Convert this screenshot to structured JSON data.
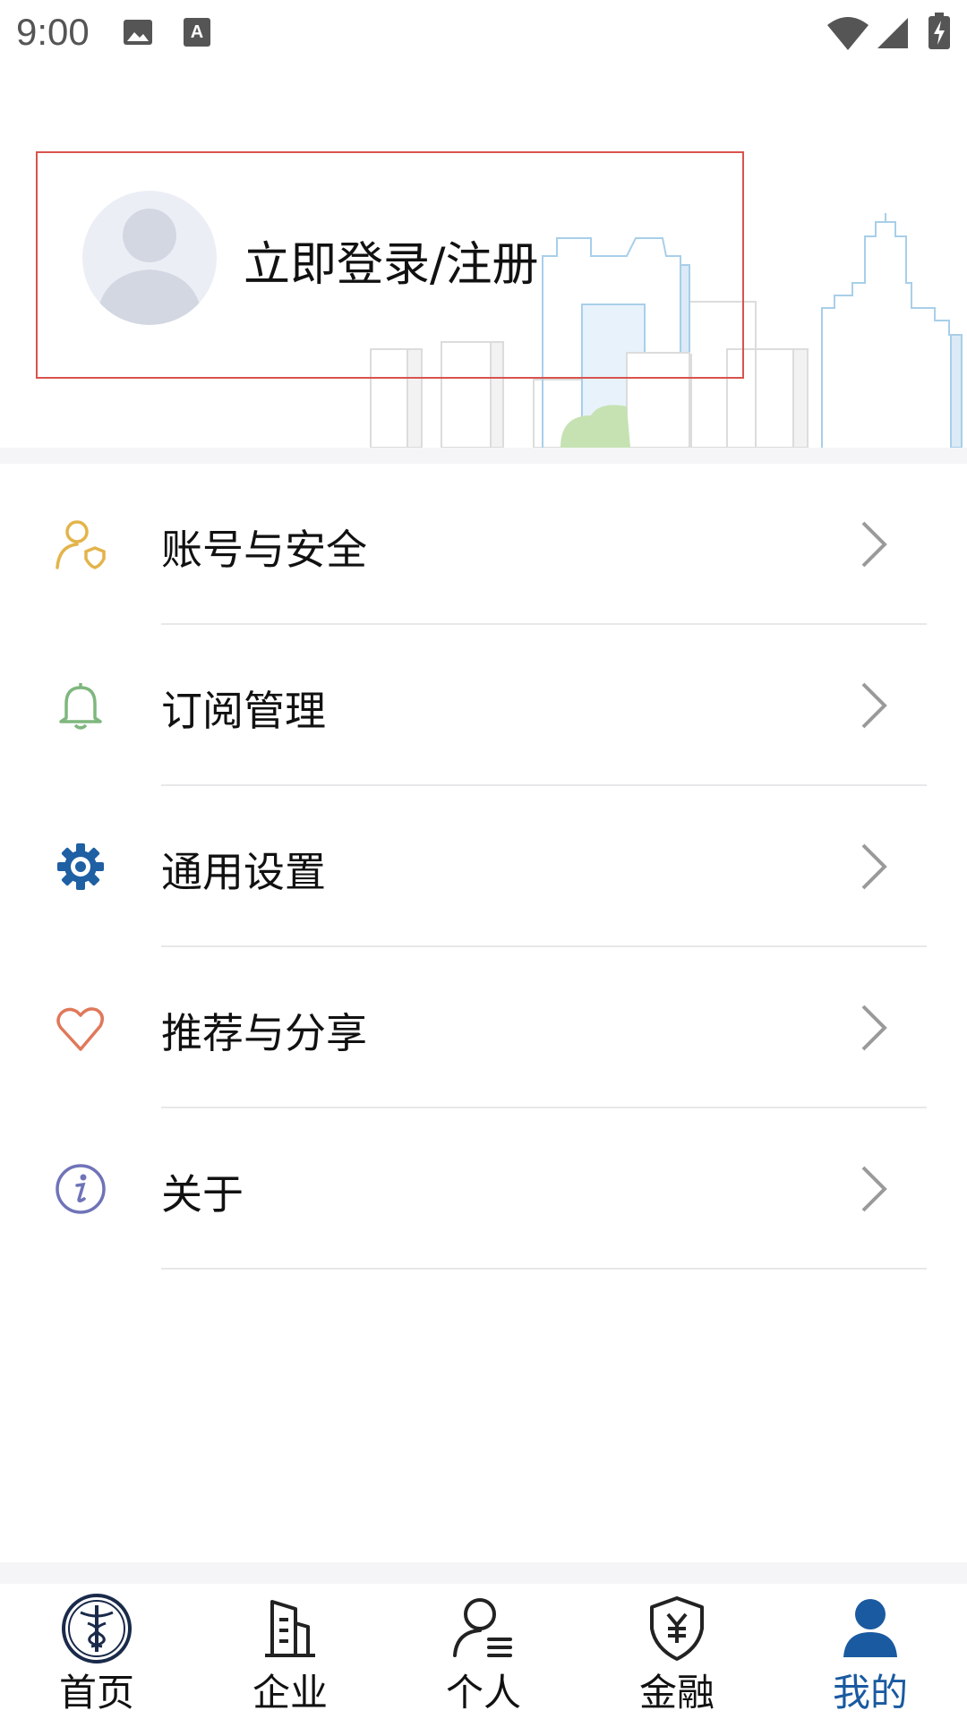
{
  "status_bar": {
    "time": "9:00",
    "icons": [
      "image-icon",
      "text-a-icon",
      "wifi-icon",
      "cellular-signal-icon",
      "battery-charging-icon"
    ]
  },
  "header": {
    "login_label": "立即登录/注册"
  },
  "menu": {
    "items": [
      {
        "label": "账号与安全",
        "icon": "account-security-icon",
        "color": "#e3b44a"
      },
      {
        "label": "订阅管理",
        "icon": "bell-icon",
        "color": "#7fb77e"
      },
      {
        "label": "通用设置",
        "icon": "gear-icon",
        "color": "#1f5fa3"
      },
      {
        "label": "推荐与分享",
        "icon": "heart-icon",
        "color": "#e0785a"
      },
      {
        "label": "关于",
        "icon": "info-icon",
        "color": "#6f73b8"
      }
    ]
  },
  "bottom_nav": {
    "items": [
      {
        "label": "首页",
        "icon": "home-emblem-icon"
      },
      {
        "label": "企业",
        "icon": "building-icon"
      },
      {
        "label": "个人",
        "icon": "person-list-icon"
      },
      {
        "label": "金融",
        "icon": "yuan-shield-icon"
      },
      {
        "label": "我的",
        "icon": "user-icon",
        "active": true
      }
    ],
    "active_color": "#1a5aa0"
  }
}
